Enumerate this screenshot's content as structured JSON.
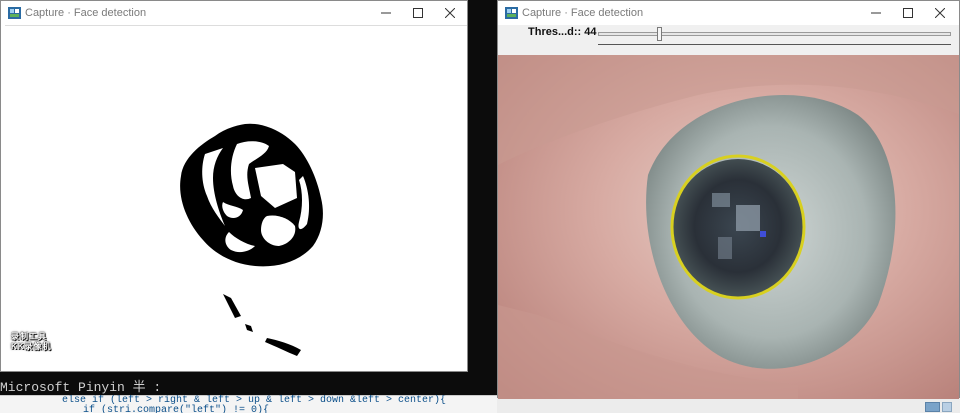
{
  "console": {
    "ime_text": "Microsoft Pinyin 半 :",
    "code_lines": [
      "else if (left > right & left > up & left > down &left > center){",
      "if (stri.compare(\"left\") != 0){"
    ]
  },
  "windows": {
    "left": {
      "title": "Capture · Face detection"
    },
    "right": {
      "title": "Capture · Face detection",
      "trackbar": {
        "label": "Thres...d:: 44",
        "value": 44,
        "max": 255
      }
    }
  },
  "title_buttons": {
    "minimize": "—",
    "maximize": "☐",
    "close": "✕"
  },
  "watermark": {
    "line1": "录制工具",
    "line2": "KK录像机"
  },
  "overlay": {
    "ellipse_color": "#d8d020"
  },
  "icons": {
    "app": "opencv-app-icon",
    "minimize": "minimize-icon",
    "maximize": "maximize-icon",
    "close": "close-icon"
  }
}
